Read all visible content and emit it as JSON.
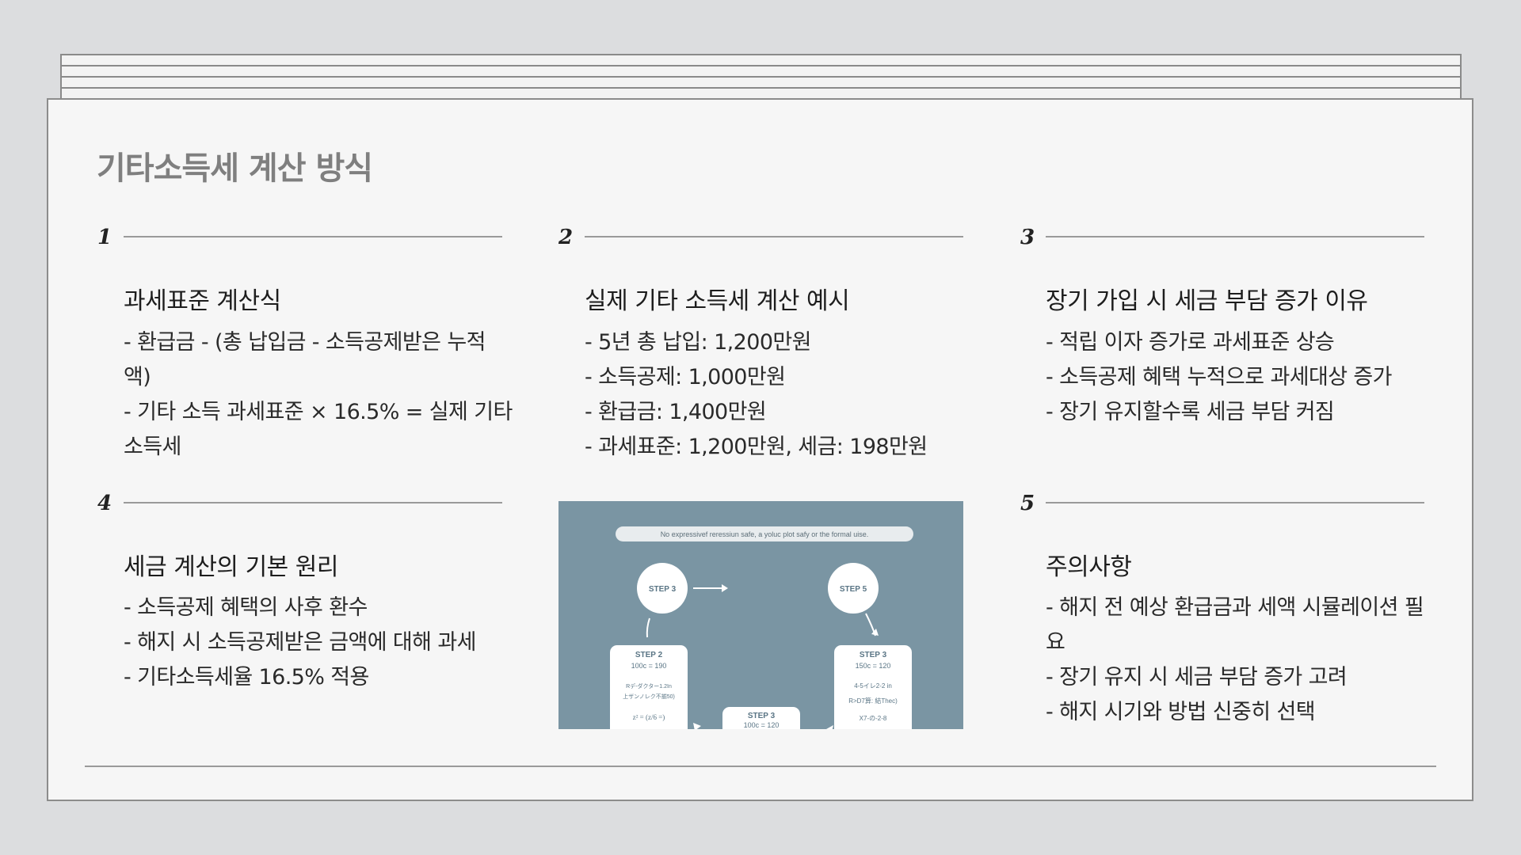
{
  "title": "기타소득세 계산 방식",
  "cards": [
    {
      "number": "1",
      "title": "과세표준 계산식",
      "lines": [
        "- 환급금 - (총 납입금 - 소득공제받은 누적",
        "액)",
        "- 기타 소득 과세표준 × 16.5% = 실제 기타",
        "소득세"
      ]
    },
    {
      "number": "2",
      "title": "실제 기타 소득세 계산 예시",
      "lines": [
        "- 5년 총 납입: 1,200만원",
        "- 소득공제: 1,000만원",
        "- 환급금: 1,400만원",
        "- 과세표준: 1,200만원, 세금: 198만원"
      ]
    },
    {
      "number": "3",
      "title": "장기 가입 시 세금 부담 증가 이유",
      "lines": [
        "- 적립 이자 증가로 과세표준 상승",
        "- 소득공제 혜택 누적으로 과세대상 증가",
        "- 장기 유지할수록 세금 부담 커짐"
      ]
    },
    {
      "number": "4",
      "title": "세금 계산의 기본 원리",
      "lines": [
        "- 소득공제 혜택의 사후 환수",
        "- 해지 시 소득공제받은 금액에 대해 과세",
        "- 기타소득세율 16.5% 적용"
      ]
    },
    {
      "number": "5",
      "title": "주의사항",
      "lines": [
        "- 해지 전 예상 환급금과 세액 시뮬레이션 필",
        "요",
        "- 장기 유지 시 세금 부담 증가 고려",
        "- 해지 시기와 방법 신중히 선택"
      ]
    }
  ],
  "diagram": {
    "banner": "No expressivef reressiun safe, a yoluc plot safy or the formal uise.",
    "circle_left": "STEP 3",
    "circle_right": "STEP 5",
    "box_left": {
      "title": "STEP 2",
      "line1": "100c = 190",
      "line2": "Rデ-ダクター1.2In",
      "line3": "上ザンノレク不揃50)",
      "line4": "z² = (z/6 =)"
    },
    "box_right": {
      "title": "STEP 3",
      "line1": "150c = 120",
      "line2": "4-5イレ2-2 in",
      "line3": "R>D7算: 結Thec)",
      "line4": "X7-の-2-8"
    },
    "box_bottom": {
      "title": "STEP 3",
      "line1": "100c = 120"
    },
    "colors": {
      "background": "#7a95a3",
      "card": "#ffffff",
      "text": "#5a7585"
    }
  }
}
